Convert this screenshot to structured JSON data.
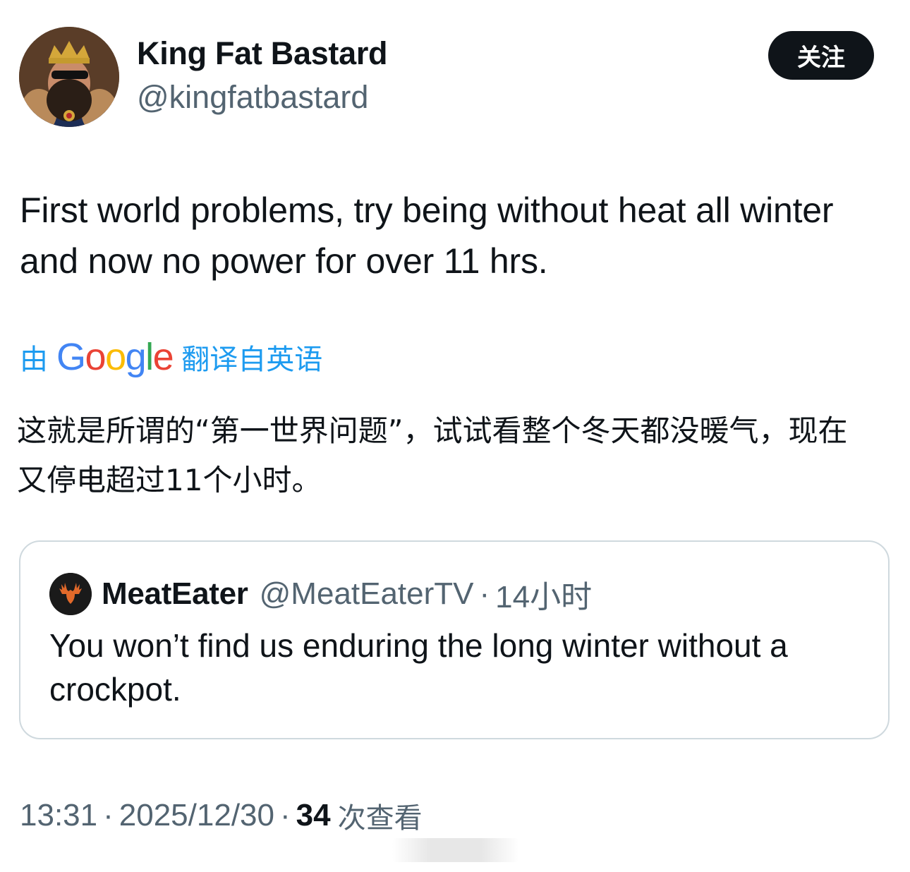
{
  "author": {
    "display_name": "King Fat Bastard",
    "handle": "@kingfatbastard",
    "avatar_icon": "king-portrait-avatar"
  },
  "follow_label": "关注",
  "tweet": {
    "text": "First world problems, try being without heat all winter and now no power for over 11 hrs."
  },
  "translation": {
    "prefix": "由",
    "provider": "Google",
    "suffix": "翻译自英语",
    "text": "这就是所谓的“第一世界问题”，试试看整个冬天都没暖气，现在又停电超过11个小时。"
  },
  "quote": {
    "display_name": "MeatEater",
    "handle": "@MeatEaterTV",
    "separator": "·",
    "time": "14小时",
    "text": "You won’t find us enduring the long winter without a crockpot.",
    "avatar_icon": "moose-antlers-logo"
  },
  "meta": {
    "time": "13:31",
    "separator": "·",
    "date": "2025/12/30",
    "views_count": "34",
    "views_label": "次查看"
  },
  "colors": {
    "google_blue": "#4285F4",
    "google_red": "#EA4335",
    "google_yellow": "#FBBC05",
    "google_green": "#34A853",
    "link_blue": "#1d9bf0",
    "secondary_text": "#536471"
  }
}
